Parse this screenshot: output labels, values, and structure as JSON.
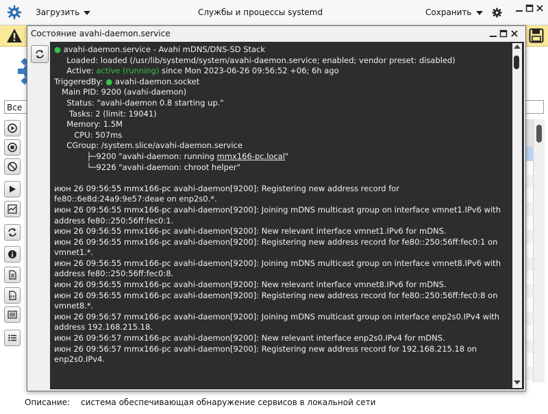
{
  "main_window": {
    "title": "Службы и процессы systemd",
    "load_menu_label": "Загрузить",
    "save_menu_label": "Сохранить",
    "filter_value": "Все п",
    "description_label": "Описание:",
    "description_value": "система обеспечивающая обнаружение сервисов в локальной сети"
  },
  "dialog": {
    "title": "Состояние avahi-daemon.service",
    "status": {
      "unit_line": "avahi-daemon.service - Avahi mDNS/DNS-SD Stack",
      "loaded": "     Loaded: loaded (/usr/lib/systemd/system/avahi-daemon.service; enabled; vendor preset: disabled)",
      "active_prefix": "     Active: ",
      "active_state": "active (running)",
      "active_suffix": " since Mon 2023-06-26 09:56:52 +06; 6h ago",
      "triggered_prefix": "TriggeredBy: ",
      "triggered_unit": "avahi-daemon.socket",
      "main_pid": "   Main PID: 9200 (avahi-daemon)",
      "status_line": "     Status: \"avahi-daemon 0.8 starting up.\"",
      "tasks": "      Tasks: 2 (limit: 19041)",
      "memory": "     Memory: 1.5M",
      "cpu": "        CPU: 507ms",
      "cgroup": "     CGroup: /system.slice/avahi-daemon.service",
      "proc1_prefix": "             ├─9200 \"avahi-daemon: running ",
      "proc1_host": "mmx166-pc.local",
      "proc1_suffix": "\"",
      "proc2": "             └─9226 \"avahi-daemon: chroot helper\""
    },
    "log_lines": [
      "июн 26 09:56:55 mmx166-pc avahi-daemon[9200]: Registering new address record for fe80::6e8d:24a9:9e57:deae on enp2s0.*.",
      "июн 26 09:56:55 mmx166-pc avahi-daemon[9200]: Joining mDNS multicast group on interface vmnet1.IPv6 with address fe80::250:56ff:fec0:1.",
      "июн 26 09:56:55 mmx166-pc avahi-daemon[9200]: New relevant interface vmnet1.IPv6 for mDNS.",
      "июн 26 09:56:55 mmx166-pc avahi-daemon[9200]: Registering new address record for fe80::250:56ff:fec0:1 on vmnet1.*.",
      "июн 26 09:56:55 mmx166-pc avahi-daemon[9200]: Joining mDNS multicast group on interface vmnet8.IPv6 with address fe80::250:56ff:fec0:8.",
      "июн 26 09:56:55 mmx166-pc avahi-daemon[9200]: New relevant interface vmnet8.IPv6 for mDNS.",
      "июн 26 09:56:55 mmx166-pc avahi-daemon[9200]: Registering new address record for fe80::250:56ff:fec0:8 on vmnet8.*.",
      "июн 26 09:56:57 mmx166-pc avahi-daemon[9200]: Joining mDNS multicast group on interface enp2s0.IPv4 with address 192.168.215.18.",
      "июн 26 09:56:57 mmx166-pc avahi-daemon[9200]: New relevant interface enp2s0.IPv4 for mDNS.",
      "июн 26 09:56:57 mmx166-pc avahi-daemon[9200]: Registering new address record for 192.168.215.18 on enp2s0.IPv4."
    ]
  },
  "colors": {
    "terminal_bg": "#2d2d2d",
    "active_green": "#33c24a",
    "warning_bar": "#fbe99a"
  },
  "icons": {
    "app": "gear-icon",
    "warning": "warning-icon",
    "save": "floppy-icon",
    "refresh": "refresh-icon"
  }
}
